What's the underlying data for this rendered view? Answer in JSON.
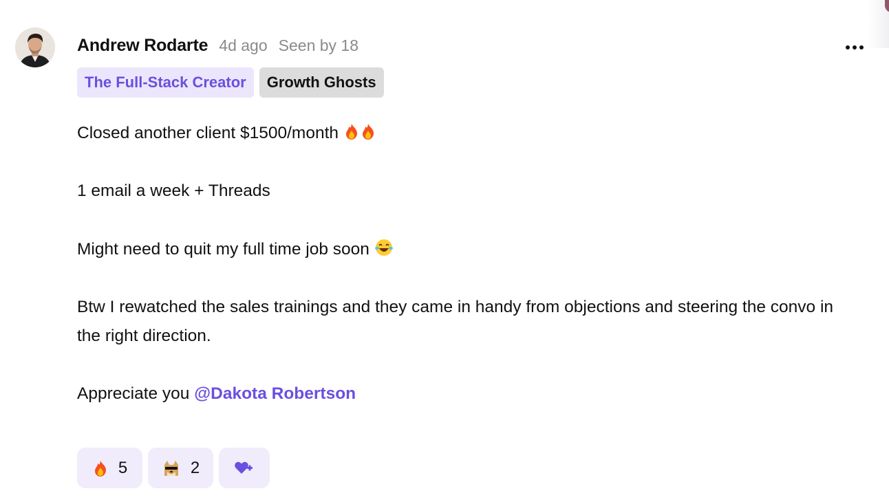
{
  "post": {
    "author": "Andrew Rodarte",
    "time_ago": "4d ago",
    "seen_by": "Seen by 18",
    "tags": [
      {
        "label": "The Full-Stack Creator",
        "style": "primary"
      },
      {
        "label": "Growth Ghosts",
        "style": "secondary"
      }
    ],
    "paragraphs": [
      "Closed another client $1500/month",
      "1 email a week + Threads",
      "Might need to quit my full time job soon",
      "Btw I rewatched the sales trainings and they came in handy from objections and steering the convo in the right direction.",
      "Appreciate you"
    ],
    "mention": "@Dakota Robertson",
    "reactions": [
      {
        "icon": "fire-emoji-icon",
        "count": "5"
      },
      {
        "icon": "doge-sunglasses-emoji-icon",
        "count": "2"
      }
    ],
    "add_reaction_icon": "add-reaction-heart-icon",
    "more_menu_icon": "more-horizontal-icon"
  },
  "colors": {
    "accent": "#6b4fe0",
    "tag_primary_bg": "#ece6fc",
    "tag_secondary_bg": "#dcdcdc",
    "reaction_bg": "#f0ecfb",
    "muted_text": "#8a8a8a"
  }
}
